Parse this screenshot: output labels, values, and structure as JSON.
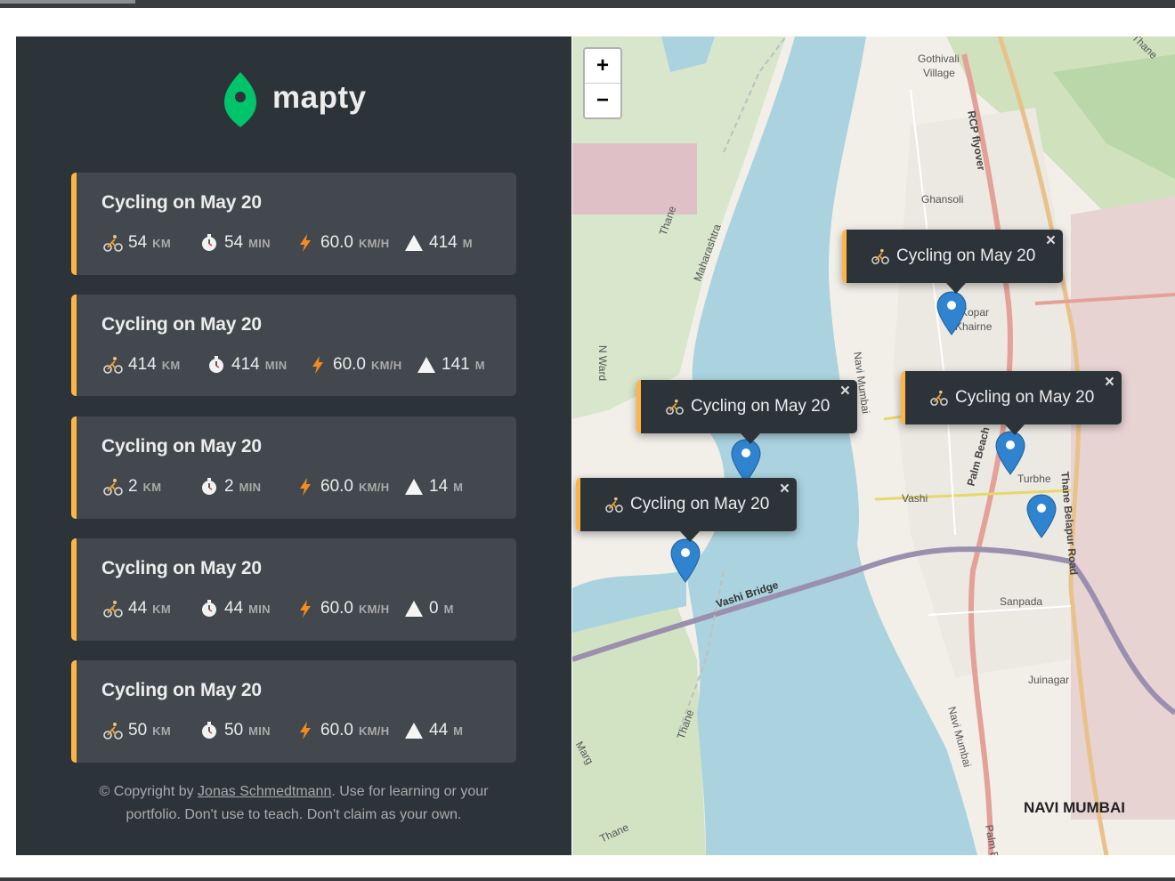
{
  "app": {
    "logo_text": "mapty"
  },
  "colors": {
    "sidebar_bg": "#2d3439",
    "card_bg": "#42484d",
    "accent_cycling": "#ffb545",
    "text": "#ececec"
  },
  "workouts": [
    {
      "title": "Cycling on May 20",
      "distance": "54",
      "distance_unit": "km",
      "duration": "54",
      "duration_unit": "min",
      "speed": "60.0",
      "speed_unit": "km/h",
      "elevation": "414",
      "elevation_unit": "m"
    },
    {
      "title": "Cycling on May 20",
      "distance": "414",
      "distance_unit": "km",
      "duration": "414",
      "duration_unit": "min",
      "speed": "60.0",
      "speed_unit": "km/h",
      "elevation": "141",
      "elevation_unit": "m"
    },
    {
      "title": "Cycling on May 20",
      "distance": "2",
      "distance_unit": "km",
      "duration": "2",
      "duration_unit": "min",
      "speed": "60.0",
      "speed_unit": "km/h",
      "elevation": "14",
      "elevation_unit": "m"
    },
    {
      "title": "Cycling on May 20",
      "distance": "44",
      "distance_unit": "km",
      "duration": "44",
      "duration_unit": "min",
      "speed": "60.0",
      "speed_unit": "km/h",
      "elevation": "0",
      "elevation_unit": "m"
    },
    {
      "title": "Cycling on May 20",
      "distance": "50",
      "distance_unit": "km",
      "duration": "50",
      "duration_unit": "min",
      "speed": "60.0",
      "speed_unit": "km/h",
      "elevation": "44",
      "elevation_unit": "m"
    }
  ],
  "copyright": {
    "prefix": "© Copyright by ",
    "author": "Jonas Schmedtmann",
    "suffix": ". Use for learning or your portfolio. Don't use to teach. Don't claim as your own."
  },
  "map": {
    "zoom_in": "+",
    "zoom_out": "−",
    "popups": [
      {
        "title": "Cycling on May 20",
        "close": "×"
      },
      {
        "title": "Cycling on May 20",
        "close": "×"
      },
      {
        "title": "Cycling on May 20",
        "close": "×"
      },
      {
        "title": "Cycling on May 20",
        "close": "×"
      }
    ],
    "labels": {
      "gothivali": "Gothivali",
      "village": "Village",
      "rcp_flyover": "RCP flyover",
      "ghansoli": "Ghansoli",
      "kopar": "Kopar",
      "khairne": "Khairne",
      "thane1": "Thane",
      "thane2": "Thane",
      "thane3": "Thane",
      "thane4": "Thane",
      "maharashtra": "Maharashtra",
      "n_ward": "N Ward",
      "navi_mumbai_road": "Navi Mumbai",
      "palm_beach": "Palm Beach",
      "vashi": "Vashi",
      "turbhe": "Turbhe",
      "thane_belapur": "Thane Belapur Road",
      "vashi_bridge": "Vashi Bridge",
      "sanpada": "Sanpada",
      "juinagar": "Juinagar",
      "navi_mumbai_road2": "Navi Mumbai",
      "navi_mumbai_city": "NAVI MUMBAI",
      "marg": "Marg",
      "palm_b": "Palm B"
    }
  }
}
